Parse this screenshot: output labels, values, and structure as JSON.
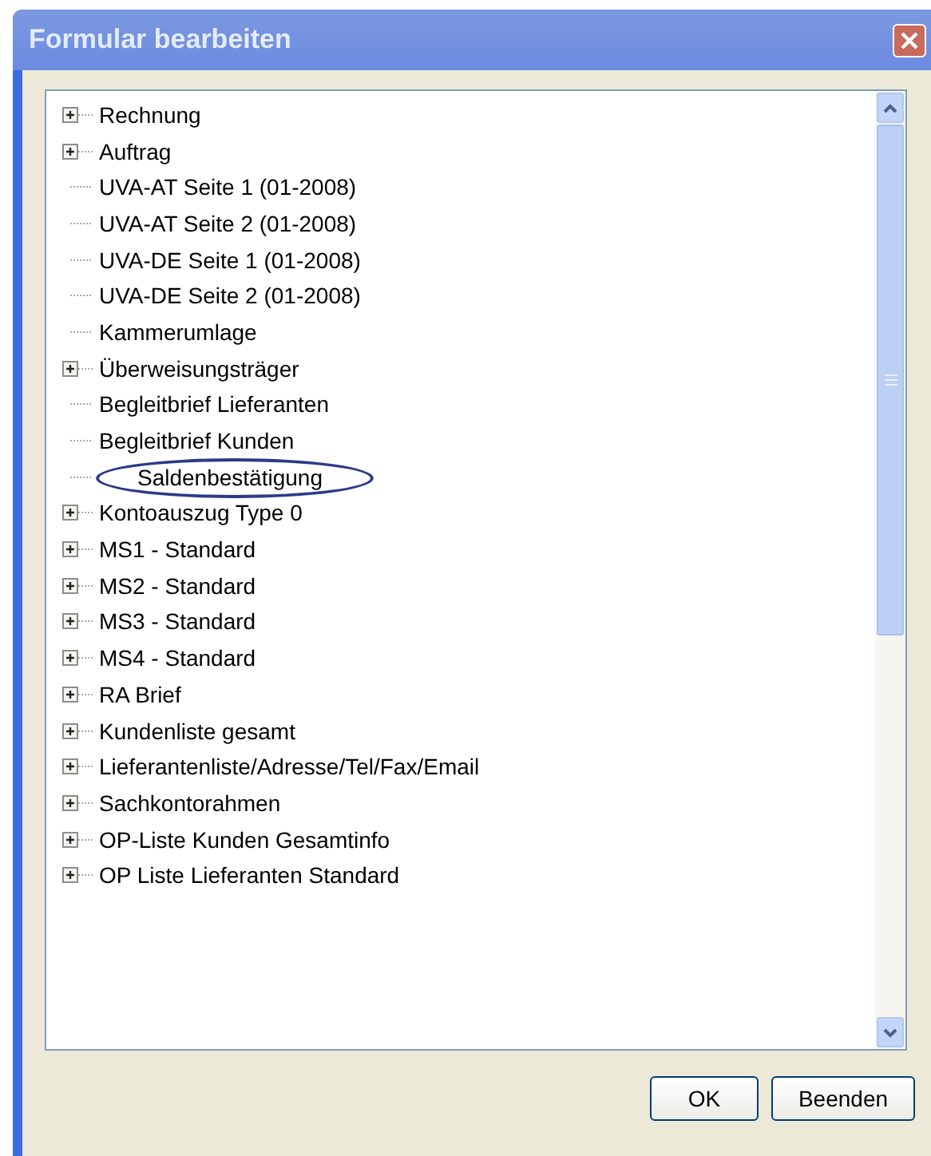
{
  "window": {
    "title": "Formular bearbeiten"
  },
  "tree": {
    "items": [
      {
        "label": "Rechnung",
        "expandable": true,
        "circled": false
      },
      {
        "label": "Auftrag",
        "expandable": true,
        "circled": false
      },
      {
        "label": "UVA-AT Seite 1 (01-2008)",
        "expandable": false,
        "circled": false
      },
      {
        "label": "UVA-AT Seite 2 (01-2008)",
        "expandable": false,
        "circled": false
      },
      {
        "label": "UVA-DE Seite 1 (01-2008)",
        "expandable": false,
        "circled": false
      },
      {
        "label": "UVA-DE Seite 2 (01-2008)",
        "expandable": false,
        "circled": false
      },
      {
        "label": "Kammerumlage",
        "expandable": false,
        "circled": false
      },
      {
        "label": "Überweisungsträger",
        "expandable": true,
        "circled": false
      },
      {
        "label": "Begleitbrief Lieferanten",
        "expandable": false,
        "circled": false
      },
      {
        "label": "Begleitbrief Kunden",
        "expandable": false,
        "circled": false
      },
      {
        "label": "Saldenbestätigung",
        "expandable": false,
        "circled": true
      },
      {
        "label": "Kontoauszug Type 0",
        "expandable": true,
        "circled": false
      },
      {
        "label": "MS1 - Standard",
        "expandable": true,
        "circled": false
      },
      {
        "label": "MS2 - Standard",
        "expandable": true,
        "circled": false
      },
      {
        "label": "MS3 - Standard",
        "expandable": true,
        "circled": false
      },
      {
        "label": "MS4 - Standard",
        "expandable": true,
        "circled": false
      },
      {
        "label": "RA Brief",
        "expandable": true,
        "circled": false
      },
      {
        "label": "Kundenliste gesamt",
        "expandable": true,
        "circled": false
      },
      {
        "label": "Lieferantenliste/Adresse/Tel/Fax/Email",
        "expandable": true,
        "circled": false
      },
      {
        "label": "Sachkontorahmen",
        "expandable": true,
        "circled": false
      },
      {
        "label": "OP-Liste Kunden Gesamtinfo",
        "expandable": true,
        "circled": false
      },
      {
        "label": "OP Liste Lieferanten Standard",
        "expandable": true,
        "circled": false
      }
    ]
  },
  "buttons": [
    {
      "label": "OK"
    },
    {
      "label": "Beenden"
    }
  ]
}
